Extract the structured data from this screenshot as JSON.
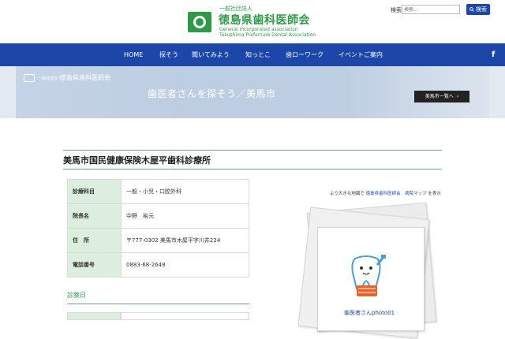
{
  "header": {
    "logo_small": "一般社団法人",
    "logo_main": "徳島県歯科医師会",
    "logo_en_1": "General incorporated association",
    "logo_en_2": "Tokushima Prefecture Dental Association",
    "search_label": "検索",
    "search_placeholder": "検索...",
    "search_button": "検索"
  },
  "nav": {
    "items": [
      "HOME",
      "探そう",
      "聞いてみよう",
      "知っとこ",
      "歯ローワーク",
      "イベントご案内"
    ],
    "facebook": "f"
  },
  "hero": {
    "assoc_small": "一般社団法人",
    "assoc": "徳島県歯科医師会",
    "title": "歯医者さんを探そう／美馬市",
    "button": "美馬市一覧へ",
    "button_arrow": "›"
  },
  "clinic": {
    "name": "美馬市国民健康保険木屋平歯科診療所",
    "rows": [
      {
        "key": "診療科目",
        "value": "一般・小児・口腔外科"
      },
      {
        "key": "院長名",
        "value": "中野　裕元"
      },
      {
        "key": "住　所",
        "value": "〒777-0302 美馬市木屋平字川井224"
      },
      {
        "key": "電話番号",
        "value": "0883-68-2648"
      }
    ],
    "schedule_heading": "診察日"
  },
  "map": {
    "prefix": "より大きな地図で",
    "link": "徳島県歯科医師会　病院マップ",
    "suffix": "を表示"
  },
  "photo": {
    "caption": "歯医者さんphoto01"
  },
  "colors": {
    "brand_green": "#2e9a48",
    "nav_blue": "#1c47a8",
    "table_key_bg": "#dcefdf"
  }
}
